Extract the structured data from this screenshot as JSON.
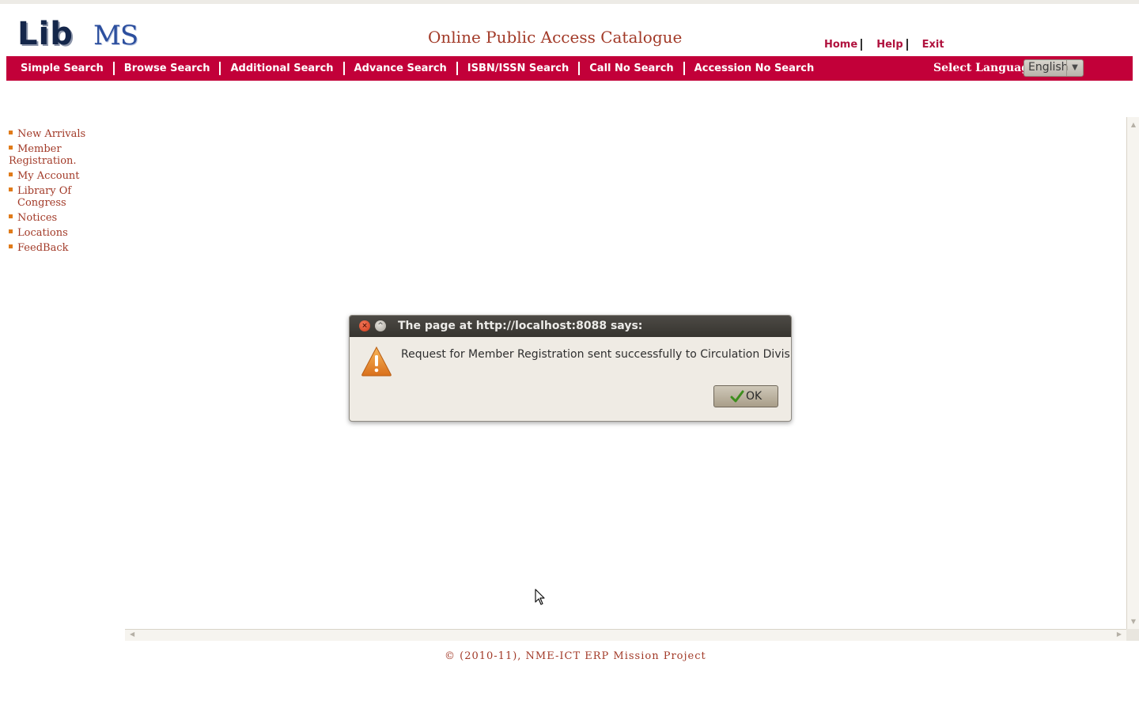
{
  "header": {
    "logo": {
      "text_lib": "Lib",
      "text_ms": "MS"
    },
    "title": "Online Public Access Catalogue",
    "links": [
      "Home",
      "Help",
      "Exit"
    ]
  },
  "nav": {
    "items": [
      "Simple Search",
      "Browse Search",
      "Additional Search",
      "Advance Search",
      "ISBN/ISSN Search",
      "Call No Search",
      "Accession No Search"
    ],
    "language_label": "Select Language",
    "language_value": "English"
  },
  "sidebar": {
    "items": [
      "New Arrivals",
      "Member Registration.",
      "My Account",
      "Library Of Congress",
      "Notices",
      "Locations",
      "FeedBack"
    ]
  },
  "footer": {
    "text": "© (2010-11), NME-ICT ERP Mission Project"
  },
  "dialog": {
    "title": "The page at http://localhost:8088 says:",
    "message": "Request for Member Registration sent successfully to Circulation Division",
    "ok_label": "OK"
  },
  "colors": {
    "accent": "#c20039",
    "link": "#a23a28",
    "bullet": "#e07b1a"
  },
  "icons": [
    "warning-icon",
    "check-icon",
    "close-icon",
    "maximize-icon",
    "mouse-cursor-icon"
  ]
}
